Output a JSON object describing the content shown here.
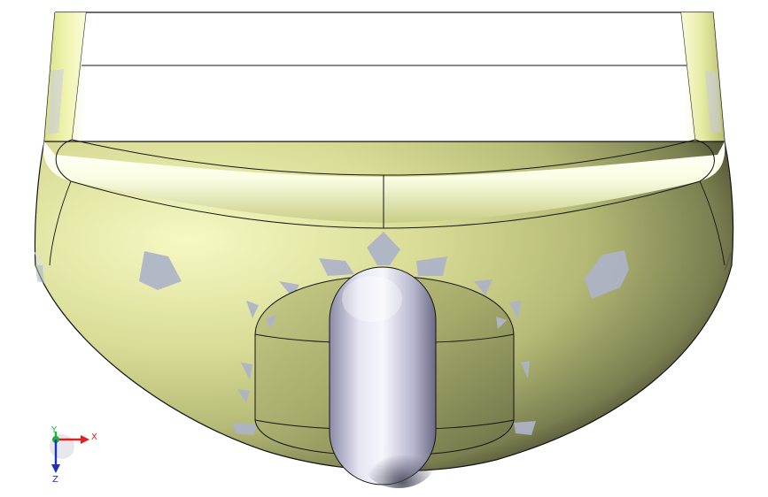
{
  "viewport": {
    "background": "#ffffff",
    "model": {
      "body_color_light": "#f3f7b8",
      "body_color_mid": "#b8bd78",
      "body_color_dark": "#1a1b12",
      "highlight_color": "#ffffff",
      "decal_color": "#b2b7cc",
      "knob_color_light": "#f4f4fb",
      "knob_color_dark": "#55556b",
      "edge_color": "#141414"
    }
  },
  "triad": {
    "x_label": "X",
    "y_label": "Y",
    "z_label": "Z",
    "x_color": "#e02020",
    "y_color": "#20b040",
    "z_color": "#2030c0"
  }
}
